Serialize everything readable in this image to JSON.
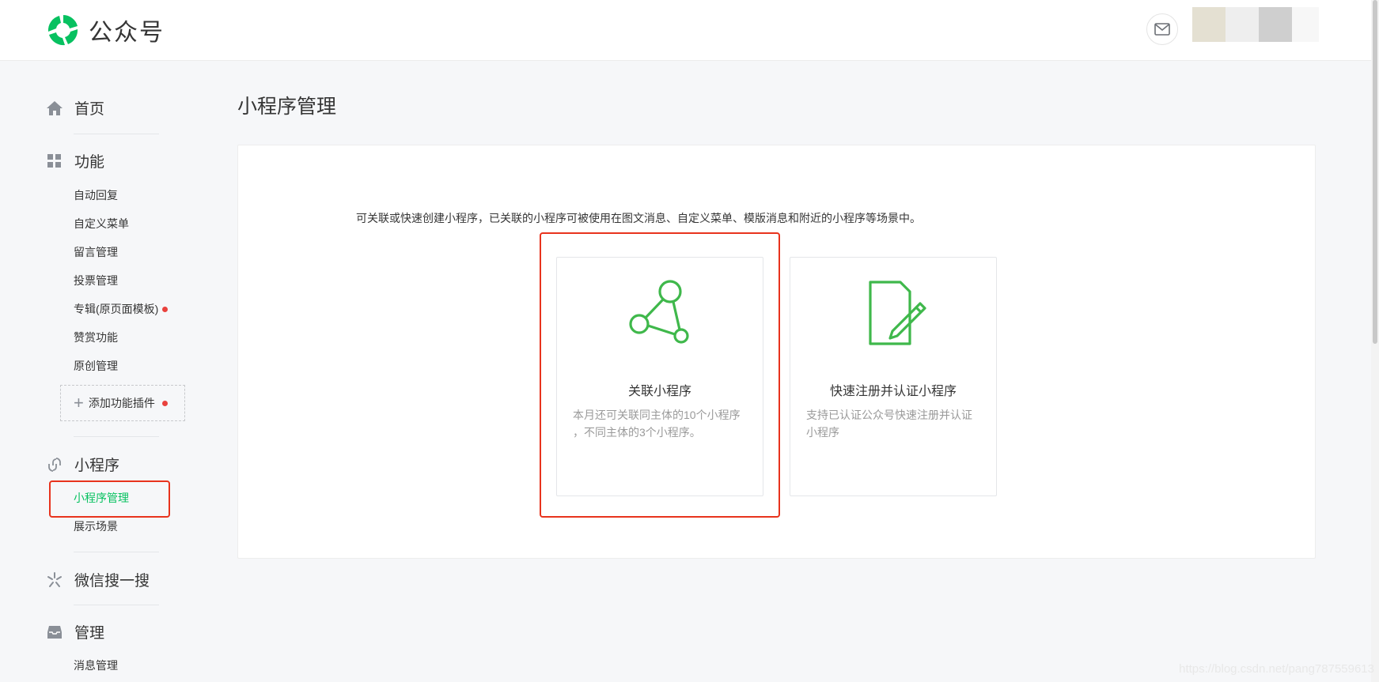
{
  "header": {
    "logo_text": "公众号",
    "mail_icon": "mail-icon",
    "brand_color": "#07c160"
  },
  "sidebar": {
    "home": {
      "icon": "home-icon",
      "label": "首页"
    },
    "features": {
      "icon": "grid-icon",
      "label": "功能",
      "items": [
        {
          "label": "自动回复"
        },
        {
          "label": "自定义菜单"
        },
        {
          "label": "留言管理"
        },
        {
          "label": "投票管理"
        },
        {
          "label": "专辑(原页面模板)"
        },
        {
          "label": "赞赏功能"
        },
        {
          "label": "原创管理"
        }
      ],
      "add_plugin_label": "添加功能插件"
    },
    "miniprogram": {
      "icon": "link-icon",
      "label": "小程序",
      "items": [
        {
          "label": "小程序管理"
        },
        {
          "label": "展示场景"
        }
      ]
    },
    "search": {
      "icon": "search-sparkle-icon",
      "label": "微信搜一搜"
    },
    "manage": {
      "icon": "inbox-icon",
      "label": "管理",
      "items": [
        {
          "label": "消息管理"
        }
      ]
    }
  },
  "main": {
    "title": "小程序管理",
    "description": "可关联或快速创建小程序，已关联的小程序可被使用在图文消息、自定义菜单、模版消息和附近的小程序等场景中。",
    "cards": [
      {
        "icon": "network-icon",
        "title": "关联小程序",
        "desc_line1": "本月还可关联同主体的10个小程序",
        "desc_line2": "，不同主体的3个小程序。"
      },
      {
        "icon": "document-edit-icon",
        "title": "快速注册并认证小程序",
        "desc_line1": "支持已认证公众号快速注册并认证",
        "desc_line2": "小程序"
      }
    ]
  },
  "watermark": "https://blog.csdn.net/pang787559613"
}
